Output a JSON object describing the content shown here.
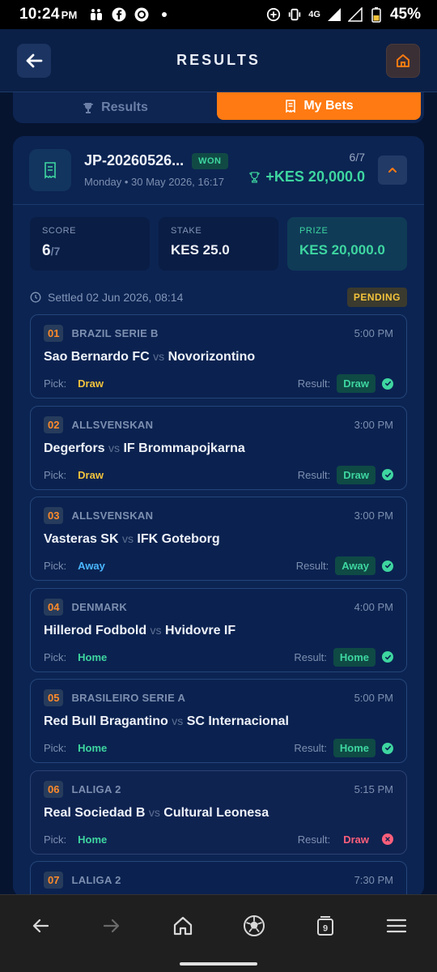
{
  "status_bar": {
    "time": "10:24",
    "ampm": "PM",
    "network": "4G",
    "battery": "45%"
  },
  "header": {
    "title": "RESULTS"
  },
  "tabs": [
    {
      "label": "Results"
    },
    {
      "label": "My Bets"
    }
  ],
  "ticket": {
    "id": "JP-20260526...",
    "status": "WON",
    "date": "Monday • 30 May 2026, 16:17",
    "score_fraction": "6/7",
    "winnings": "+KES 20,000.0",
    "stats": {
      "score_label": "SCORE",
      "score_value": "6",
      "score_total": "/7",
      "stake_label": "STAKE",
      "stake_value": "KES 25.0",
      "prize_label": "PRIZE",
      "prize_value": "KES 20,000.0"
    },
    "settled": "Settled 02 Jun 2026, 08:14",
    "settle_status": "PENDING"
  },
  "labels": {
    "pick": "Pick:",
    "result": "Result:",
    "vs": "vs"
  },
  "matches": [
    {
      "num": "01",
      "league": "BRAZIL SERIE B",
      "time": "5:00 PM",
      "home": "Sao Bernardo FC",
      "away": "Novorizontino",
      "pick": "Draw",
      "result": "Draw",
      "correct": true
    },
    {
      "num": "02",
      "league": "ALLSVENSKAN",
      "time": "3:00 PM",
      "home": "Degerfors",
      "away": "IF Brommapojkarna",
      "pick": "Draw",
      "result": "Draw",
      "correct": true
    },
    {
      "num": "03",
      "league": "ALLSVENSKAN",
      "time": "3:00 PM",
      "home": "Vasteras SK",
      "away": "IFK Goteborg",
      "pick": "Away",
      "result": "Away",
      "correct": true
    },
    {
      "num": "04",
      "league": "DENMARK",
      "time": "4:00 PM",
      "home": "Hillerod Fodbold",
      "away": "Hvidovre IF",
      "pick": "Home",
      "result": "Home",
      "correct": true
    },
    {
      "num": "05",
      "league": "BRASILEIRO SERIE A",
      "time": "5:00 PM",
      "home": "Red Bull Bragantino",
      "away": "SC Internacional",
      "pick": "Home",
      "result": "Home",
      "correct": true
    },
    {
      "num": "06",
      "league": "LALIGA 2",
      "time": "5:15 PM",
      "home": "Real Sociedad B",
      "away": "Cultural Leonesa",
      "pick": "Home",
      "result": "Draw",
      "correct": false
    },
    {
      "num": "07",
      "league": "LALIGA 2",
      "time": "7:30 PM",
      "home": "",
      "away": "",
      "pick": "",
      "result": "",
      "correct": null
    }
  ],
  "navbar": {
    "tab_count": "9"
  },
  "colors": {
    "accent": "#ff7a12",
    "won": "#3ed6a0",
    "lost": "#ff5f7a",
    "draw": "#f3c33c",
    "away": "#4ab7ff",
    "background": "#061430"
  }
}
